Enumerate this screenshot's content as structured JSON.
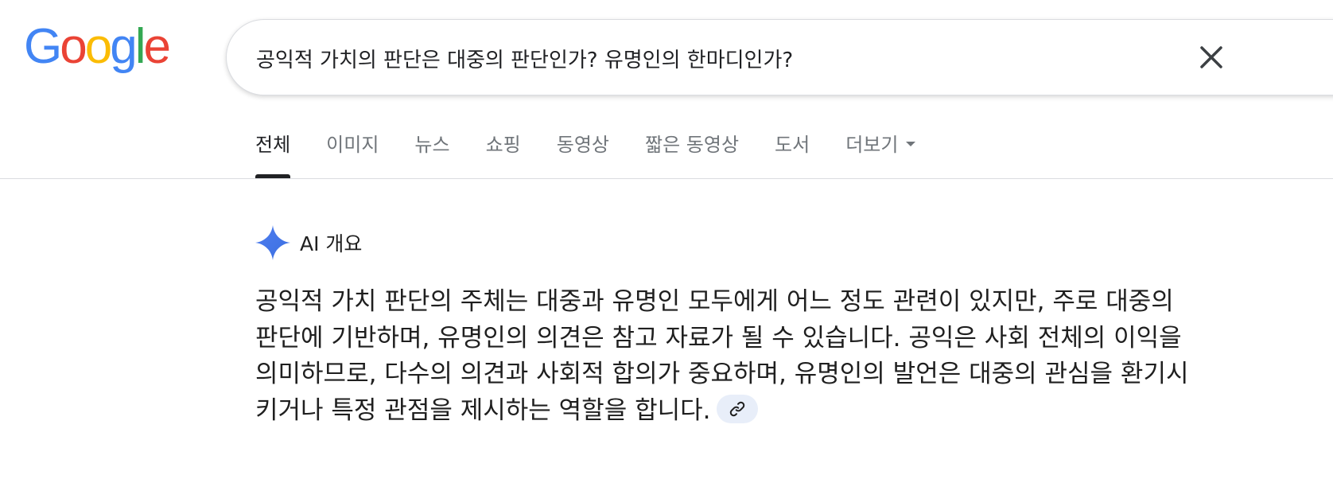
{
  "logo": {
    "letters": [
      "G",
      "o",
      "o",
      "g",
      "l",
      "e"
    ],
    "colors": [
      "#4285F4",
      "#EA4335",
      "#FBBC05",
      "#4285F4",
      "#34A853",
      "#EA4335"
    ]
  },
  "search": {
    "query": "공익적 가치의 판단은 대중의 판단인가? 유명인의 한마디인가?",
    "clear_icon": "close-icon"
  },
  "tabs": [
    {
      "label": "전체",
      "active": true
    },
    {
      "label": "이미지"
    },
    {
      "label": "뉴스"
    },
    {
      "label": "쇼핑"
    },
    {
      "label": "동영상"
    },
    {
      "label": "짧은 동영상"
    },
    {
      "label": "도서"
    },
    {
      "label": "더보기",
      "icon": "caret-down-icon"
    }
  ],
  "ai_overview": {
    "icon": "gemini-sparkle-icon",
    "title": "AI 개요",
    "body": "공익적 가치 판단의 주체는 대중과 유명인 모두에게 어느 정도 관련이 있지만, 주로 대중의 판단에 기반하며, 유명인의 의견은 참고 자료가 될 수 있습니다. 공익은 사회 전체의 이익을 의미하므로, 다수의 의견과 사회적 합의가 중요하며, 유명인의 발언은 대중의 관심을 환기시키거나 특정 관점을 제시하는 역할을 합니다.",
    "link_icon": "link-icon"
  },
  "colors": {
    "accent_blue": "#4285F4",
    "tab_inactive": "#70757a",
    "tab_active": "#202124",
    "chip_bg": "#e8eef9"
  }
}
